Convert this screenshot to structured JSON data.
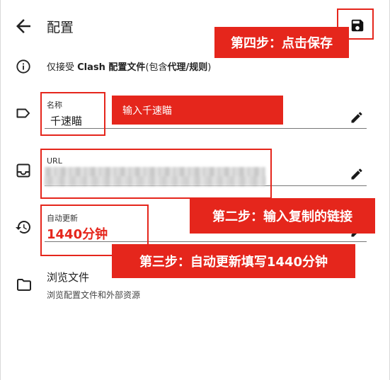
{
  "header": {
    "title": "配置",
    "back_icon": "arrow-left-icon",
    "save_icon": "floppy-disk-icon"
  },
  "info": {
    "text_prefix": "仅接受 ",
    "text_bold_1": "Clash 配置文件",
    "text_mid": "(包含",
    "text_bold_2": "代理/规则",
    "text_suffix": ")",
    "icon": "info-icon"
  },
  "fields": {
    "name": {
      "label": "名称",
      "value": "千速瞄",
      "icon": "tag-label-icon",
      "edit_icon": "pencil-icon"
    },
    "url": {
      "label": "URL",
      "icon": "inbox-tray-icon",
      "edit_icon": "pencil-icon"
    },
    "auto_update": {
      "label": "自动更新",
      "value": "1440分钟",
      "icon": "history-clock-icon",
      "edit_icon": "pencil-icon"
    }
  },
  "browse": {
    "title": "浏览文件",
    "subtitle": "浏览配置文件和外部资源",
    "icon": "folder-icon"
  },
  "annotations": {
    "step4": "第四步：点击保存",
    "name_hint": "输入千速瞄",
    "step2": "第二步：输入复制的链接",
    "step3": "第三步：自动更新填写1440分钟"
  },
  "colors": {
    "annotation_red": "#e5261c",
    "update_value_red": "#e5261c",
    "text": "#1c1c1c"
  }
}
